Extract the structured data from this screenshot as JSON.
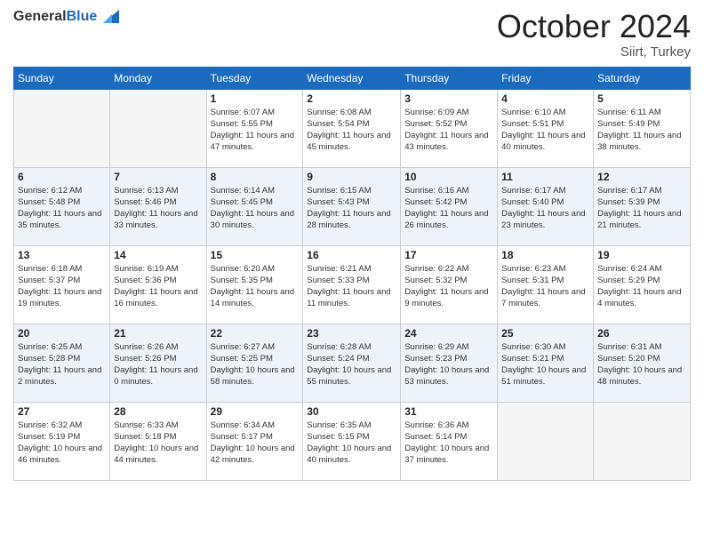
{
  "header": {
    "logo": {
      "general": "General",
      "blue": "Blue",
      "tagline": ""
    },
    "title": "October 2024",
    "location": "Siirt, Turkey"
  },
  "columns": [
    "Sunday",
    "Monday",
    "Tuesday",
    "Wednesday",
    "Thursday",
    "Friday",
    "Saturday"
  ],
  "weeks": [
    [
      {
        "day": "",
        "sunrise": "",
        "sunset": "",
        "daylight": ""
      },
      {
        "day": "",
        "sunrise": "",
        "sunset": "",
        "daylight": ""
      },
      {
        "day": "1",
        "sunrise": "Sunrise: 6:07 AM",
        "sunset": "Sunset: 5:55 PM",
        "daylight": "Daylight: 11 hours and 47 minutes."
      },
      {
        "day": "2",
        "sunrise": "Sunrise: 6:08 AM",
        "sunset": "Sunset: 5:54 PM",
        "daylight": "Daylight: 11 hours and 45 minutes."
      },
      {
        "day": "3",
        "sunrise": "Sunrise: 6:09 AM",
        "sunset": "Sunset: 5:52 PM",
        "daylight": "Daylight: 11 hours and 43 minutes."
      },
      {
        "day": "4",
        "sunrise": "Sunrise: 6:10 AM",
        "sunset": "Sunset: 5:51 PM",
        "daylight": "Daylight: 11 hours and 40 minutes."
      },
      {
        "day": "5",
        "sunrise": "Sunrise: 6:11 AM",
        "sunset": "Sunset: 5:49 PM",
        "daylight": "Daylight: 11 hours and 38 minutes."
      }
    ],
    [
      {
        "day": "6",
        "sunrise": "Sunrise: 6:12 AM",
        "sunset": "Sunset: 5:48 PM",
        "daylight": "Daylight: 11 hours and 35 minutes."
      },
      {
        "day": "7",
        "sunrise": "Sunrise: 6:13 AM",
        "sunset": "Sunset: 5:46 PM",
        "daylight": "Daylight: 11 hours and 33 minutes."
      },
      {
        "day": "8",
        "sunrise": "Sunrise: 6:14 AM",
        "sunset": "Sunset: 5:45 PM",
        "daylight": "Daylight: 11 hours and 30 minutes."
      },
      {
        "day": "9",
        "sunrise": "Sunrise: 6:15 AM",
        "sunset": "Sunset: 5:43 PM",
        "daylight": "Daylight: 11 hours and 28 minutes."
      },
      {
        "day": "10",
        "sunrise": "Sunrise: 6:16 AM",
        "sunset": "Sunset: 5:42 PM",
        "daylight": "Daylight: 11 hours and 26 minutes."
      },
      {
        "day": "11",
        "sunrise": "Sunrise: 6:17 AM",
        "sunset": "Sunset: 5:40 PM",
        "daylight": "Daylight: 11 hours and 23 minutes."
      },
      {
        "day": "12",
        "sunrise": "Sunrise: 6:17 AM",
        "sunset": "Sunset: 5:39 PM",
        "daylight": "Daylight: 11 hours and 21 minutes."
      }
    ],
    [
      {
        "day": "13",
        "sunrise": "Sunrise: 6:18 AM",
        "sunset": "Sunset: 5:37 PM",
        "daylight": "Daylight: 11 hours and 19 minutes."
      },
      {
        "day": "14",
        "sunrise": "Sunrise: 6:19 AM",
        "sunset": "Sunset: 5:36 PM",
        "daylight": "Daylight: 11 hours and 16 minutes."
      },
      {
        "day": "15",
        "sunrise": "Sunrise: 6:20 AM",
        "sunset": "Sunset: 5:35 PM",
        "daylight": "Daylight: 11 hours and 14 minutes."
      },
      {
        "day": "16",
        "sunrise": "Sunrise: 6:21 AM",
        "sunset": "Sunset: 5:33 PM",
        "daylight": "Daylight: 11 hours and 11 minutes."
      },
      {
        "day": "17",
        "sunrise": "Sunrise: 6:22 AM",
        "sunset": "Sunset: 5:32 PM",
        "daylight": "Daylight: 11 hours and 9 minutes."
      },
      {
        "day": "18",
        "sunrise": "Sunrise: 6:23 AM",
        "sunset": "Sunset: 5:31 PM",
        "daylight": "Daylight: 11 hours and 7 minutes."
      },
      {
        "day": "19",
        "sunrise": "Sunrise: 6:24 AM",
        "sunset": "Sunset: 5:29 PM",
        "daylight": "Daylight: 11 hours and 4 minutes."
      }
    ],
    [
      {
        "day": "20",
        "sunrise": "Sunrise: 6:25 AM",
        "sunset": "Sunset: 5:28 PM",
        "daylight": "Daylight: 11 hours and 2 minutes."
      },
      {
        "day": "21",
        "sunrise": "Sunrise: 6:26 AM",
        "sunset": "Sunset: 5:26 PM",
        "daylight": "Daylight: 11 hours and 0 minutes."
      },
      {
        "day": "22",
        "sunrise": "Sunrise: 6:27 AM",
        "sunset": "Sunset: 5:25 PM",
        "daylight": "Daylight: 10 hours and 58 minutes."
      },
      {
        "day": "23",
        "sunrise": "Sunrise: 6:28 AM",
        "sunset": "Sunset: 5:24 PM",
        "daylight": "Daylight: 10 hours and 55 minutes."
      },
      {
        "day": "24",
        "sunrise": "Sunrise: 6:29 AM",
        "sunset": "Sunset: 5:23 PM",
        "daylight": "Daylight: 10 hours and 53 minutes."
      },
      {
        "day": "25",
        "sunrise": "Sunrise: 6:30 AM",
        "sunset": "Sunset: 5:21 PM",
        "daylight": "Daylight: 10 hours and 51 minutes."
      },
      {
        "day": "26",
        "sunrise": "Sunrise: 6:31 AM",
        "sunset": "Sunset: 5:20 PM",
        "daylight": "Daylight: 10 hours and 48 minutes."
      }
    ],
    [
      {
        "day": "27",
        "sunrise": "Sunrise: 6:32 AM",
        "sunset": "Sunset: 5:19 PM",
        "daylight": "Daylight: 10 hours and 46 minutes."
      },
      {
        "day": "28",
        "sunrise": "Sunrise: 6:33 AM",
        "sunset": "Sunset: 5:18 PM",
        "daylight": "Daylight: 10 hours and 44 minutes."
      },
      {
        "day": "29",
        "sunrise": "Sunrise: 6:34 AM",
        "sunset": "Sunset: 5:17 PM",
        "daylight": "Daylight: 10 hours and 42 minutes."
      },
      {
        "day": "30",
        "sunrise": "Sunrise: 6:35 AM",
        "sunset": "Sunset: 5:15 PM",
        "daylight": "Daylight: 10 hours and 40 minutes."
      },
      {
        "day": "31",
        "sunrise": "Sunrise: 6:36 AM",
        "sunset": "Sunset: 5:14 PM",
        "daylight": "Daylight: 10 hours and 37 minutes."
      },
      {
        "day": "",
        "sunrise": "",
        "sunset": "",
        "daylight": ""
      },
      {
        "day": "",
        "sunrise": "",
        "sunset": "",
        "daylight": ""
      }
    ]
  ]
}
